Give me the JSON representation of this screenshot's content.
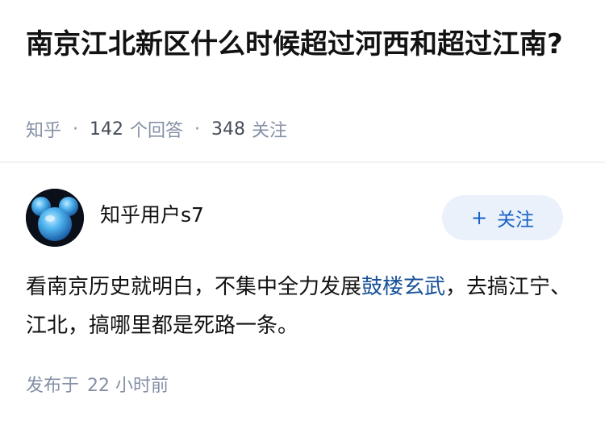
{
  "question": {
    "title": "南京江北新区什么时候超过河西和超过江南?",
    "source": "知乎",
    "answer_count": "142",
    "answer_label": "个回答",
    "follower_count": "348",
    "follower_label": "关注"
  },
  "answer": {
    "author_name": "知乎用户s7",
    "follow_button_label": "关注",
    "follow_button_icon": "plus-icon",
    "content_before_link": "看南京历史就明白，不集中全力发展",
    "content_link": "鼓楼玄武",
    "content_after_link": "，去搞江宁、江北，搞哪里都是死路一条。",
    "published_label": "发布于",
    "published_time": "22 小时前"
  },
  "colors": {
    "accent": "#1762c6",
    "link": "#175199",
    "meta": "#8590a6",
    "follow_bg": "#eaf1fb"
  }
}
